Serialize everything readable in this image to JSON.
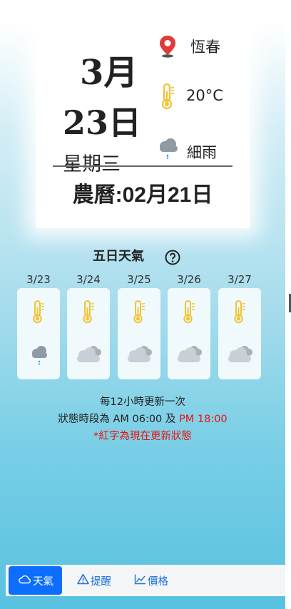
{
  "card": {
    "month": "3月",
    "day": "23日",
    "weekday": "星期三",
    "lunar": "農曆:02月21日",
    "location": "恆春",
    "temperature": "20°C",
    "condition": "細雨",
    "icons": [
      "map-pin-icon",
      "thermometer-icon",
      "rain-cloud-icon"
    ]
  },
  "forecast": {
    "title": "五日天氣",
    "help_icon": "question-circle-icon",
    "days": [
      {
        "date": "3/23",
        "temp_icon": "thermometer-icon",
        "cond_icon": "rain-cloud-icon"
      },
      {
        "date": "3/24",
        "temp_icon": "thermometer-icon",
        "cond_icon": "cloudy-icon"
      },
      {
        "date": "3/25",
        "temp_icon": "thermometer-icon",
        "cond_icon": "cloudy-icon"
      },
      {
        "date": "3/26",
        "temp_icon": "thermometer-icon",
        "cond_icon": "cloudy-icon"
      },
      {
        "date": "3/27",
        "temp_icon": "thermometer-icon",
        "cond_icon": "cloudy-icon"
      }
    ]
  },
  "notes": {
    "update_frequency": "每12小時更新一次",
    "schedule_prefix": "狀態時段為 ",
    "schedule_am": "AM 06:00",
    "schedule_and": " 及 ",
    "schedule_pm": "PM 18:00",
    "current_note": "*紅字為現在更新狀態"
  },
  "nav": {
    "tabs": [
      {
        "label": "天氣",
        "icon": "cloud-icon",
        "active": true
      },
      {
        "label": "提醒",
        "icon": "warning-triangle-icon",
        "active": false
      },
      {
        "label": "價格",
        "icon": "line-chart-icon",
        "active": false
      }
    ]
  },
  "colors": {
    "accent": "#0d6efd",
    "highlight": "#e11111",
    "thermometer": "#f2c230",
    "pin": "#e03a3a",
    "cloud": "#c9cfd6"
  }
}
